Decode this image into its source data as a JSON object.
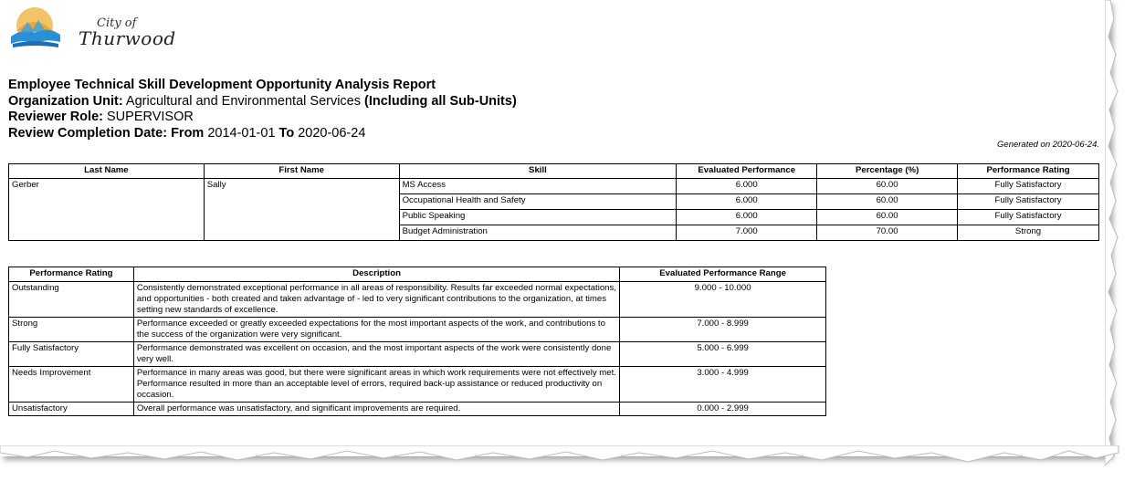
{
  "logo": {
    "city_label": "City of",
    "city_name": "Thurwood"
  },
  "report": {
    "title": "Employee Technical Skill Development Opportunity Analysis Report",
    "org_unit_label": "Organization Unit:",
    "org_unit_value": "Agricultural and Environmental Services",
    "org_unit_suffix": "(Including all Sub-Units)",
    "reviewer_role_label": "Reviewer Role:",
    "reviewer_role_value": "SUPERVISOR",
    "review_date_label": "Review Completion Date:",
    "from_label": "From",
    "from_value": "2014-01-01",
    "to_label": "To",
    "to_value": "2020-06-24",
    "generated": "Generated on 2020-06-24."
  },
  "skills_table": {
    "headers": [
      "Last Name",
      "First Name",
      "Skill",
      "Evaluated Performance",
      "Percentage (%)",
      "Performance Rating"
    ],
    "last_name": "Gerber",
    "first_name": "Sally",
    "rows": [
      {
        "skill": "MS Access",
        "evaluated": "6.000",
        "percentage": "60.00",
        "rating": "Fully Satisfactory"
      },
      {
        "skill": "Occupational Health and Safety",
        "evaluated": "6.000",
        "percentage": "60.00",
        "rating": "Fully Satisfactory"
      },
      {
        "skill": "Public Speaking",
        "evaluated": "6.000",
        "percentage": "60.00",
        "rating": "Fully Satisfactory"
      },
      {
        "skill": "Budget Administration",
        "evaluated": "7.000",
        "percentage": "70.00",
        "rating": "Strong"
      }
    ]
  },
  "rating_table": {
    "headers": [
      "Performance Rating",
      "Description",
      "Evaluated Performance Range"
    ],
    "rows": [
      {
        "rating": "Outstanding",
        "description": "Consistently demonstrated exceptional performance in all areas of responsibility. Results far exceeded normal expectations, and opportunities - both created and taken advantage of - led to very significant contributions to the organization, at times setting new standards of excellence.",
        "range": "9.000 - 10.000"
      },
      {
        "rating": "Strong",
        "description": "Performance exceeded or greatly exceeded expectations for the most important aspects of the work, and contributions to the success of the organization were very significant.",
        "range": "7.000 - 8.999"
      },
      {
        "rating": "Fully Satisfactory",
        "description": "Performance demonstrated was excellent on occasion, and the most important aspects of the work were consistently done very well.",
        "range": "5.000 - 6.999"
      },
      {
        "rating": "Needs Improvement",
        "description": "Performance in many areas was good, but there were significant areas in which work requirements were not effectively met. Performance resulted in more than an acceptable level of errors, required back-up assistance or reduced productivity on occasion.",
        "range": "3.000 - 4.999"
      },
      {
        "rating": "Unsatisfactory",
        "description": "Overall performance was unsatisfactory, and significant improvements are required.",
        "range": "0.000 - 2.999"
      }
    ]
  }
}
